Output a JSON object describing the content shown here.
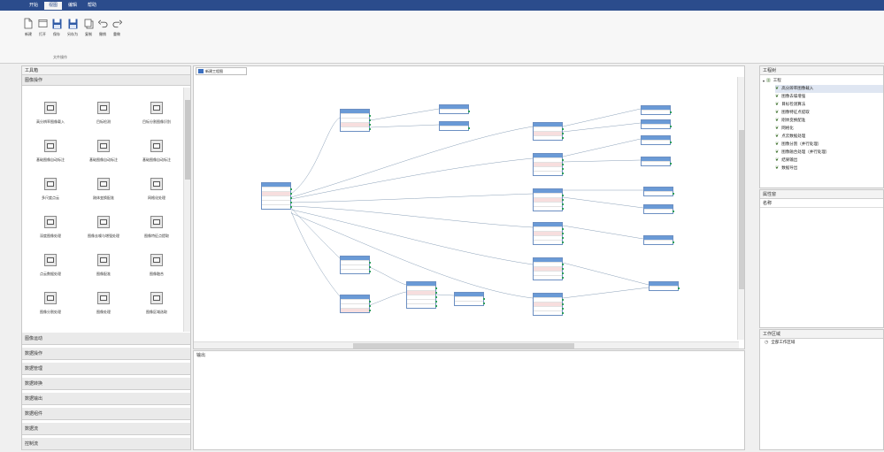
{
  "menubar": {
    "items": [
      "开始",
      "视图",
      "编辑",
      "帮助"
    ],
    "active_index": 1
  },
  "ribbon": {
    "buttons": [
      {
        "label": "新建",
        "icon": "new-file-icon"
      },
      {
        "label": "打开",
        "icon": "open-folder-icon"
      },
      {
        "label": "保存",
        "icon": "save-icon"
      },
      {
        "label": "另存为",
        "icon": "save-as-icon"
      },
      {
        "label": "复制",
        "icon": "copy-icon"
      },
      {
        "label": "撤销",
        "icon": "undo-icon"
      },
      {
        "label": "重做",
        "icon": "redo-icon"
      }
    ],
    "group_label": "文件操作"
  },
  "toolbox": {
    "title": "工具箱",
    "active_section": "图像操作",
    "tools": [
      [
        "高分辨率图像载入",
        "目标检测",
        "目标分割图像识别"
      ],
      [
        "基础图像自动标注",
        "基础图像自动标注",
        "基础图像自动标注"
      ],
      [
        "多尺度点云",
        "刚体变换配准",
        "网格化处理"
      ],
      [
        "深度图像处理",
        "图像去噪与增强处理",
        "图像特征点提取"
      ],
      [
        "点云数据处理",
        "图像配准",
        "图像融合"
      ],
      [
        "图像分割处理",
        "图像处理",
        "图像区域选取"
      ]
    ],
    "sections": [
      "图像运动",
      "数据操作",
      "数据管理",
      "数据转换",
      "数据输出",
      "数据组件",
      "数据流",
      "控制流"
    ]
  },
  "editor": {
    "tab_label": "新建工程图",
    "output_title": "输出"
  },
  "tree": {
    "title": "工程树",
    "root": "工程",
    "items": [
      "高分辨率图像载入",
      "图像去噪增强",
      "目标检测算法",
      "图像特征点提取",
      "刚体变换配准",
      "网格化",
      "点云数据处理",
      "图像分割（并行处理）",
      "图像融合处理（并行处理）",
      "结果输出",
      "数据导出"
    ]
  },
  "properties": {
    "title": "属性窗",
    "row_label": "名称"
  },
  "workspace": {
    "title": "工作区域",
    "item": "全部工作区域"
  },
  "colors": {
    "menubar": "#2b4c8c",
    "node_header": "#6a9ad6",
    "port": "#2e9d5a"
  }
}
